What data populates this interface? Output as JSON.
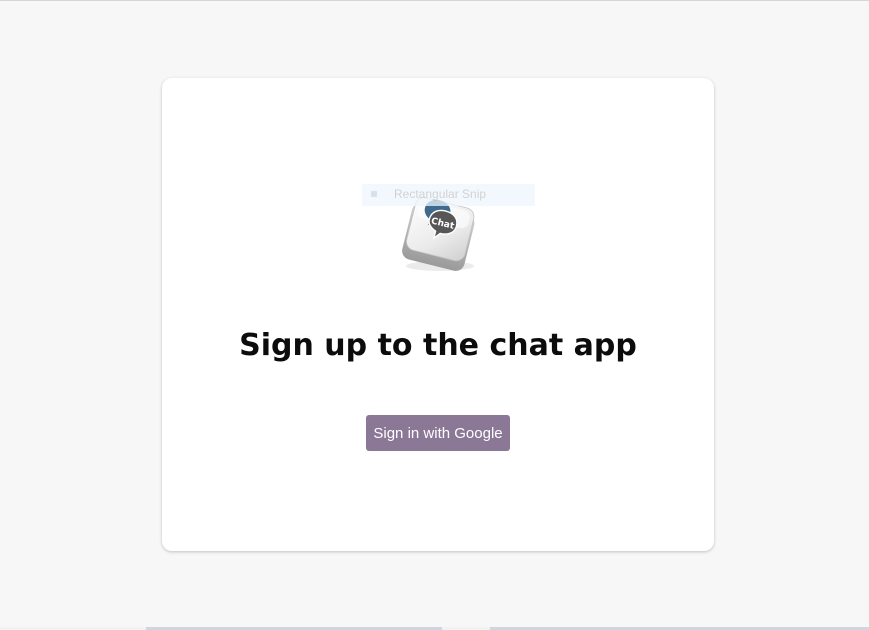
{
  "snip_overlay": {
    "label": "Rectangular Snip"
  },
  "logo": {
    "icon": "chat-key-icon",
    "text": "Chat"
  },
  "signup": {
    "title": "Sign up to the chat app",
    "google_button_label": "Sign in with Google"
  },
  "colors": {
    "page_background": "#f7f7f7",
    "card_background": "#ffffff",
    "button_background": "#8b7796",
    "button_text": "#ffffff",
    "title_text": "#0c0c0c"
  }
}
